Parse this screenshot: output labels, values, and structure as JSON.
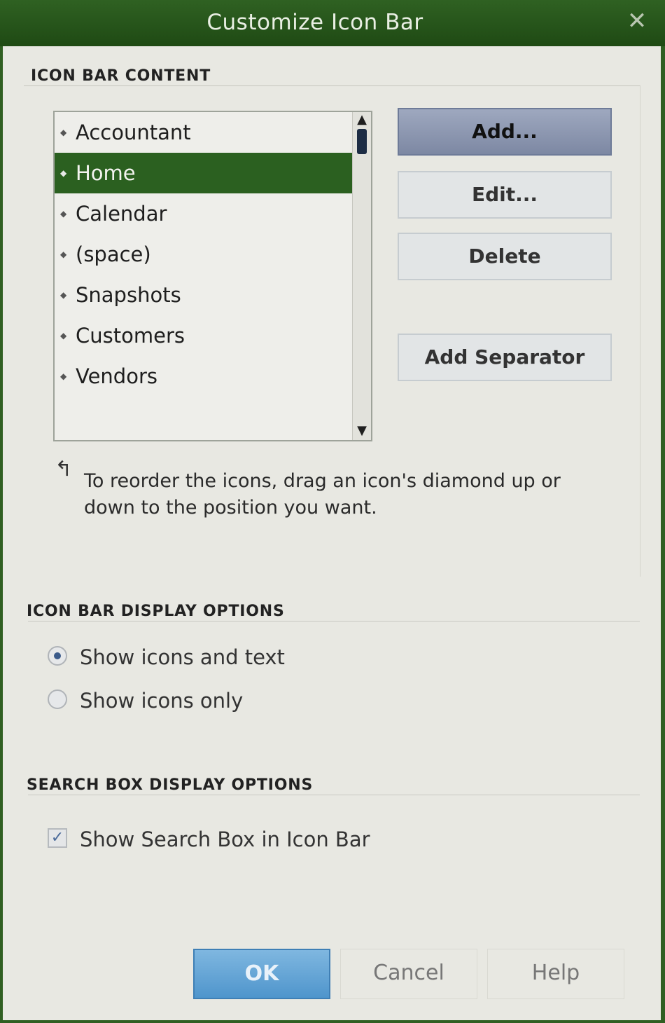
{
  "window": {
    "title": "Customize Icon Bar",
    "close_glyph": "✕"
  },
  "icon_bar_content": {
    "legend": "ICON BAR CONTENT",
    "items": [
      {
        "label": "Accountant",
        "selected": false
      },
      {
        "label": "Home",
        "selected": true
      },
      {
        "label": "Calendar",
        "selected": false
      },
      {
        "label": "(space)",
        "selected": false
      },
      {
        "label": "Snapshots",
        "selected": false
      },
      {
        "label": "Customers",
        "selected": false
      },
      {
        "label": "Vendors",
        "selected": false
      }
    ],
    "diamond_glyph": "◆",
    "scroll_up_glyph": "▲",
    "scroll_down_glyph": "▼",
    "buttons": {
      "add": "Add...",
      "edit": "Edit...",
      "delete": "Delete",
      "add_separator": "Add Separator"
    },
    "hint_arrow": "↰",
    "hint": "To reorder the icons, drag an icon's diamond up or down to the position you want."
  },
  "display_options": {
    "legend": "ICON BAR DISPLAY OPTIONS",
    "show_icons_and_text": "Show icons and text",
    "show_icons_only": "Show icons only",
    "selected": "show_icons_and_text"
  },
  "search_options": {
    "legend": "SEARCH BOX DISPLAY OPTIONS",
    "show_search_box": "Show Search Box in Icon Bar",
    "checked": true,
    "check_glyph": "✓"
  },
  "footer": {
    "ok": "OK",
    "cancel": "Cancel",
    "help": "Help"
  }
}
